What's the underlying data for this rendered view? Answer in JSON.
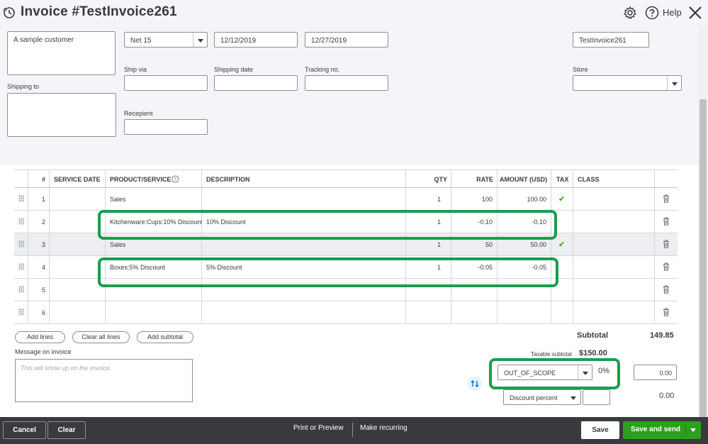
{
  "header": {
    "title": "Invoice #TestInvoice261",
    "help_label": "Help"
  },
  "form": {
    "customer_value": "A sample customer",
    "terms_value": "Net 15",
    "invoice_date": "12/12/2019",
    "due_date": "12/27/2019",
    "invoice_no": "TestInvoice261",
    "ship_via_label": "Ship via",
    "shipping_date_label": "Shipping date",
    "tracking_label": "Tracking no.",
    "store_label": "Store",
    "shipping_to_label": "Shipping to",
    "recipient_label": "Recepient"
  },
  "table": {
    "headers": {
      "num": "#",
      "service_date": "SERVICE DATE",
      "product": "PRODUCT/SERVICE",
      "description": "DESCRIPTION",
      "qty": "QTY",
      "rate": "RATE",
      "amount": "AMOUNT (USD)",
      "tax": "TAX",
      "class": "CLASS"
    },
    "rows": [
      {
        "num": "1",
        "product": "Sales",
        "description": "",
        "qty": "1",
        "rate": "100",
        "amount": "100.00",
        "tax": "✔"
      },
      {
        "num": "2",
        "product": "Kitchenware:Cups:10% Discount",
        "description": "10% Discount",
        "qty": "1",
        "rate": "-0.10",
        "amount": "-0.10",
        "tax": ""
      },
      {
        "num": "3",
        "product": "Sales",
        "description": "",
        "qty": "1",
        "rate": "50",
        "amount": "50.00",
        "tax": "✔"
      },
      {
        "num": "4",
        "product": "Boxes:5% Discount",
        "description": "5% Discount",
        "qty": "1",
        "rate": "-0.05",
        "amount": "-0.05",
        "tax": ""
      },
      {
        "num": "5",
        "product": "",
        "description": "",
        "qty": "",
        "rate": "",
        "amount": "",
        "tax": ""
      },
      {
        "num": "6",
        "product": "",
        "description": "",
        "qty": "",
        "rate": "",
        "amount": "",
        "tax": ""
      }
    ]
  },
  "actions": {
    "add_lines": "Add lines",
    "clear_all_lines": "Clear all lines",
    "add_subtotal": "Add subtotal"
  },
  "message": {
    "label": "Message on invoice",
    "placeholder": "This will show up on the invoice."
  },
  "totals": {
    "subtotal_label": "Subtotal",
    "subtotal_value": "149.85",
    "taxable_label": "Taxable subtotal",
    "taxable_value": "$150.00",
    "tax_code": "OUT_OF_SCOPE",
    "tax_rate": "0%",
    "tax_amount": "0.00",
    "discount_type": "Discount percent",
    "discount_value": "0.00"
  },
  "footer": {
    "cancel": "Cancel",
    "clear": "Clear",
    "print_preview": "Print or Preview",
    "make_recurring": "Make recurring",
    "save": "Save",
    "save_and_send": "Save and send"
  },
  "colors": {
    "highlight": "#1a9e4d",
    "tax_check": "#2ca01c",
    "bottom_bar": "#393a3d",
    "primary_button": "#2ca01c"
  }
}
